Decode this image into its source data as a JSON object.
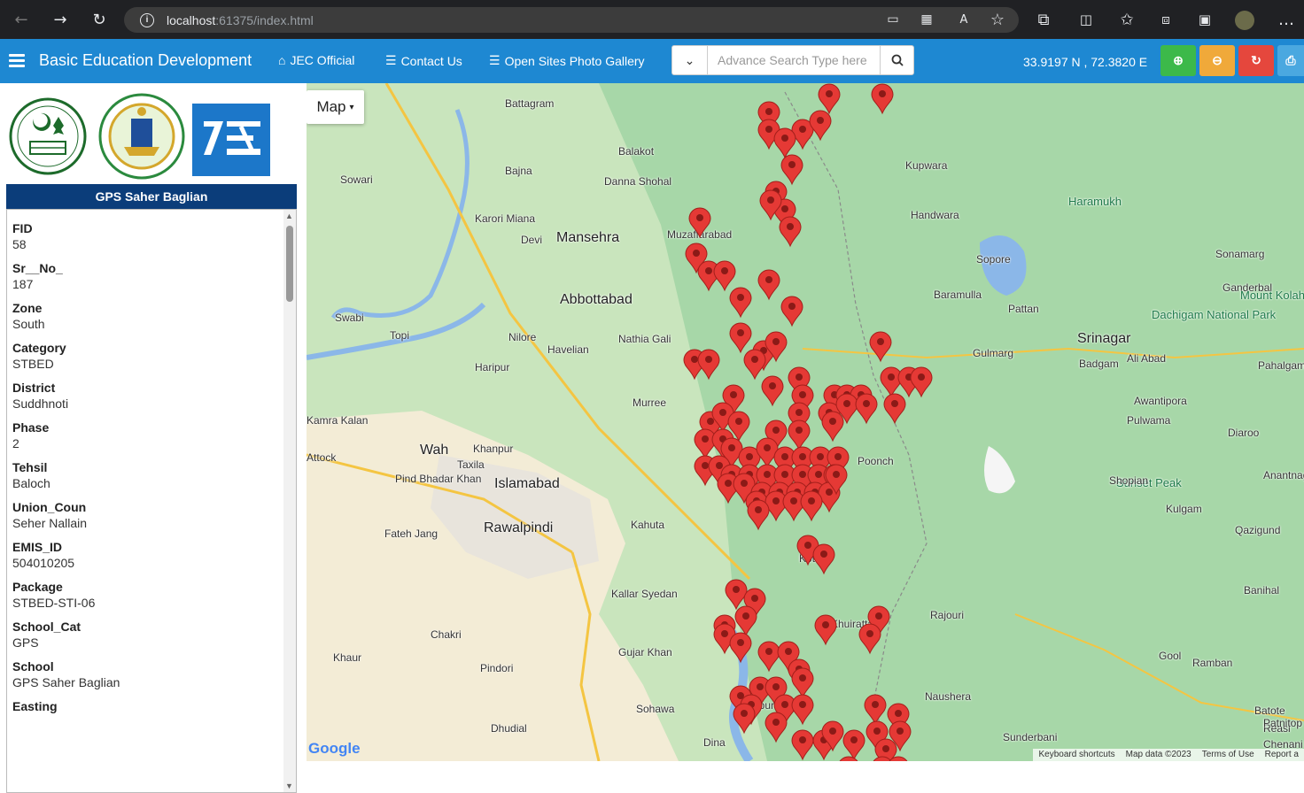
{
  "browser": {
    "url_host": "localhost",
    "url_rest": ":61375/index.html",
    "icons": [
      "back-icon",
      "forward-icon",
      "reload-icon",
      "info-icon"
    ]
  },
  "navbar": {
    "brand": "Basic Education Development",
    "links": [
      "JEC Official",
      "Contact Us",
      "Open Sites Photo Gallery"
    ],
    "search_placeholder": "Advance Search Type here",
    "coords": "33.9197 N , 72.3820 E",
    "accent": "#1e88d2"
  },
  "panel": {
    "title": "GPS Saher Baglian",
    "fields": [
      {
        "k": "FID",
        "v": "58"
      },
      {
        "k": "Sr__No_",
        "v": "187"
      },
      {
        "k": "Zone",
        "v": "South"
      },
      {
        "k": "Category",
        "v": "STBED"
      },
      {
        "k": "District",
        "v": "Suddhnoti"
      },
      {
        "k": "Phase",
        "v": "2"
      },
      {
        "k": "Tehsil",
        "v": "Baloch"
      },
      {
        "k": "Union_Coun",
        "v": "Seher Nallain"
      },
      {
        "k": "EMIS_ID",
        "v": "504010205"
      },
      {
        "k": "Package",
        "v": "STBED-STI-06"
      },
      {
        "k": "School_Cat",
        "v": "GPS"
      },
      {
        "k": "School",
        "v": "GPS Saher Baglian"
      },
      {
        "k": "Easting",
        "v": ""
      }
    ]
  },
  "map": {
    "type_label": "Map",
    "footer": [
      "Keyboard shortcuts",
      "Map data ©2023",
      "Terms of Use",
      "Report a"
    ],
    "google": "Google",
    "labels": [
      {
        "t": "Battagram"
      },
      {
        "t": "Balakot"
      },
      {
        "t": "Kupwara"
      },
      {
        "t": "Sowari"
      },
      {
        "t": "Bajna"
      },
      {
        "t": "Danna Shohal"
      },
      {
        "t": "Haramukh"
      },
      {
        "t": "Handwara"
      },
      {
        "t": "Karori Miana"
      },
      {
        "t": "Mansehra"
      },
      {
        "t": "Muzaffarabad"
      },
      {
        "t": "Devi"
      },
      {
        "t": "Sopore"
      },
      {
        "t": "Sonamarg"
      },
      {
        "t": "Abbottabad"
      },
      {
        "t": "Ganderbal"
      },
      {
        "t": "Baramulla"
      },
      {
        "t": "Mount Kolahoi"
      },
      {
        "t": "Swabi"
      },
      {
        "t": "Topi"
      },
      {
        "t": "Nilore"
      },
      {
        "t": "Havelian"
      },
      {
        "t": "Nathia Gali"
      },
      {
        "t": "Pattan"
      },
      {
        "t": "Dachigam National Park"
      },
      {
        "t": "Srinagar"
      },
      {
        "t": "Gulmarg"
      },
      {
        "t": "Badgam"
      },
      {
        "t": "Ali Abad"
      },
      {
        "t": "Pahalgam"
      },
      {
        "t": "Haripur"
      },
      {
        "t": "Murree"
      },
      {
        "t": "Awantipora"
      },
      {
        "t": "Pulwama"
      },
      {
        "t": "Kamra Kalan"
      },
      {
        "t": "Diaroo"
      },
      {
        "t": "Wah"
      },
      {
        "t": "Khanpur"
      },
      {
        "t": "Poonch"
      },
      {
        "t": "Attock"
      },
      {
        "t": "Taxila"
      },
      {
        "t": "Anantnag"
      },
      {
        "t": "Sunset Peak"
      },
      {
        "t": "Shopian"
      },
      {
        "t": "Pind Bhadar Khan"
      },
      {
        "t": "Islamabad"
      },
      {
        "t": "Kulgam"
      },
      {
        "t": "Rawalpindi"
      },
      {
        "t": "Kahuta"
      },
      {
        "t": "Fateh Jang"
      },
      {
        "t": "Qazigund"
      },
      {
        "t": "Kotli"
      },
      {
        "t": "Banihal"
      },
      {
        "t": "Kallar Syedan"
      },
      {
        "t": "Khuiratta"
      },
      {
        "t": "Rajouri"
      },
      {
        "t": "Chakri"
      },
      {
        "t": "Khaur"
      },
      {
        "t": "Gujar Khan"
      },
      {
        "t": "Gool"
      },
      {
        "t": "Pindori"
      },
      {
        "t": "Ramban"
      },
      {
        "t": "Naushera"
      },
      {
        "t": "Sohawa"
      },
      {
        "t": "Batote"
      },
      {
        "t": "Dhudial"
      },
      {
        "t": "Reasi"
      },
      {
        "t": "Patnitop"
      },
      {
        "t": "Sunderbani"
      },
      {
        "t": "Dina"
      },
      {
        "t": "Chenani"
      },
      {
        "t": "Mirpur"
      }
    ]
  }
}
